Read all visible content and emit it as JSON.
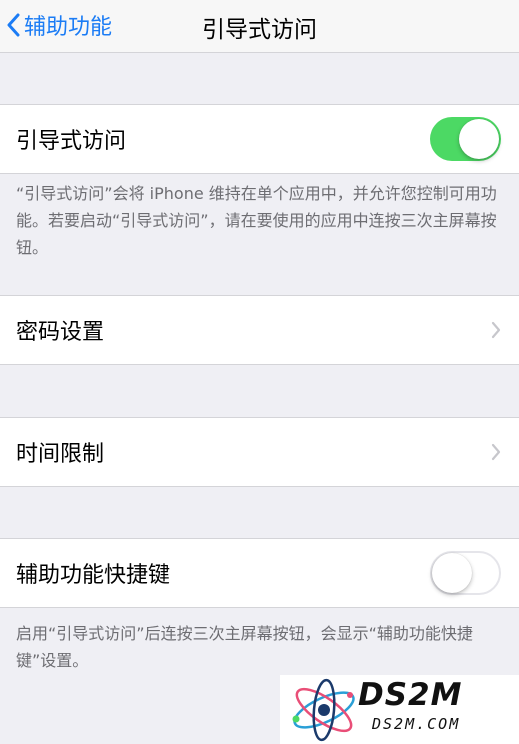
{
  "navbar": {
    "back_label": "辅助功能",
    "title": "引导式访问"
  },
  "guided_access": {
    "label": "引导式访问",
    "toggle_on": true,
    "description": "“引导式访问”会将 iPhone 维持在单个应用中，并允许您控制可用功能。若要启动“引导式访问”，请在要使用的应用中连按三次主屏幕按钮。"
  },
  "passcode_settings": {
    "label": "密码设置"
  },
  "time_limits": {
    "label": "时间限制"
  },
  "accessibility_shortcut": {
    "label": "辅助功能快捷键",
    "toggle_on": false,
    "description": "启用“引导式访问”后连按三次主屏幕按钮，会显示“辅助功能快捷键”设置。"
  },
  "watermark": {
    "brand": "DS2M",
    "url": "DS2M.COM"
  },
  "colors": {
    "accent": "#1b7cf5",
    "toggle_on": "#4cd964",
    "background": "#efeff4"
  }
}
